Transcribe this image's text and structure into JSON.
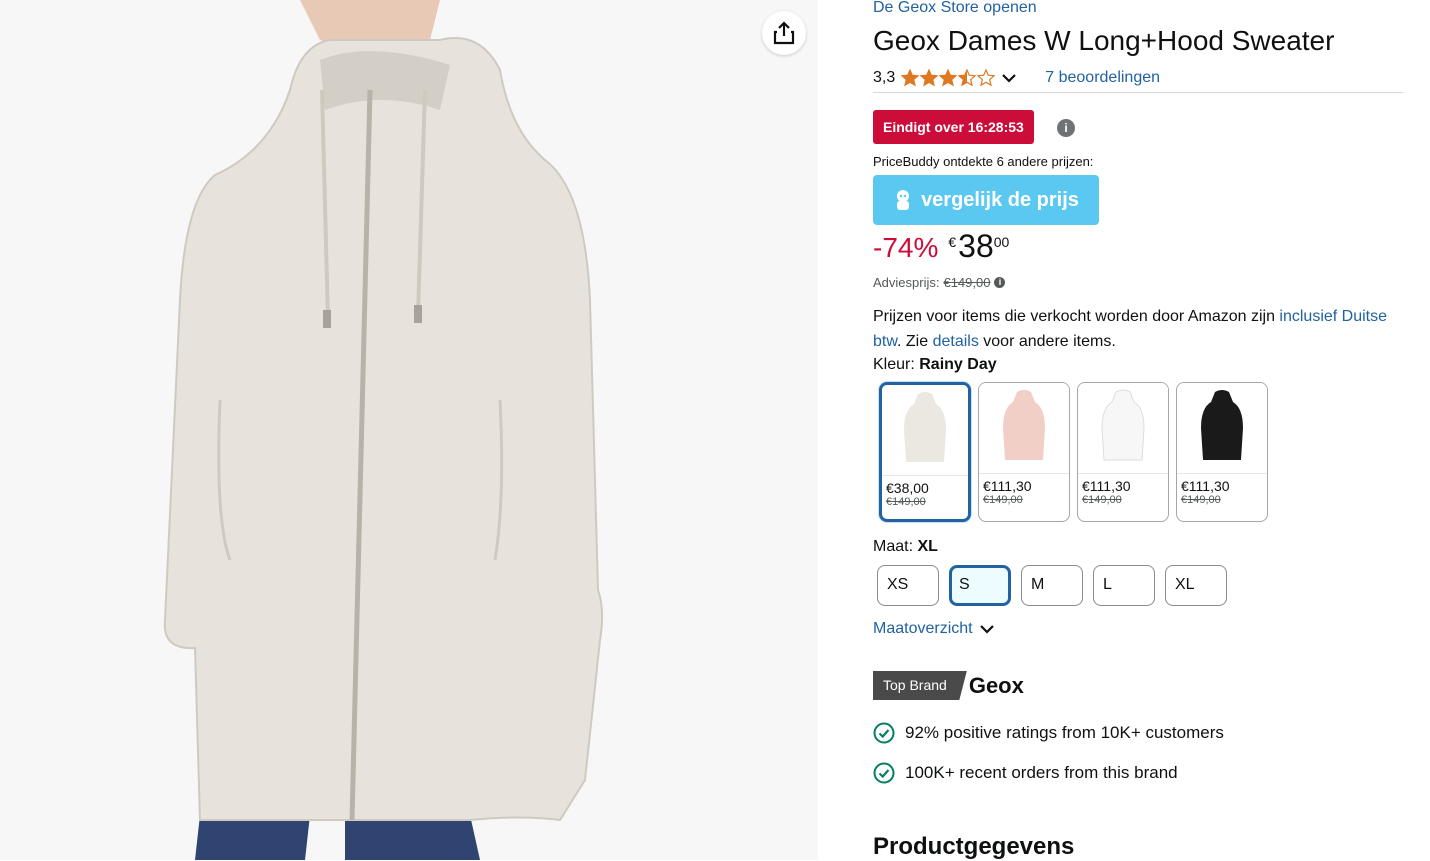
{
  "store": {
    "link": "De Geox Store openen"
  },
  "product": {
    "title": "Geox Dames W Long+Hood Sweater"
  },
  "rating": {
    "value": "3,3",
    "reviews": "7 beoordelingen",
    "stars": 3.5
  },
  "deal": {
    "badge": "Eindigt over 16:28:53",
    "info": "i"
  },
  "pricebuddy": {
    "text": "PriceBuddy ontdekte 6 andere prijzen:",
    "button": "vergelijk de prijs"
  },
  "price": {
    "discount": "-74%",
    "currency": "€",
    "whole": "38",
    "fraction": "00",
    "list_label": "Adviesprijs:",
    "list_value": "€149,00"
  },
  "vat": {
    "text1": "Prijzen voor items die verkocht worden door Amazon zijn ",
    "link1": "inclusief Duitse btw",
    "text2": ". Zie ",
    "link2": "details",
    "text3": " voor andere items."
  },
  "color": {
    "label": "Kleur: ",
    "selected": "Rainy Day",
    "options": [
      {
        "price": "€38,00",
        "old": "€149,00",
        "color": "#ebe8e1"
      },
      {
        "price": "€111,30",
        "old": "€149,00",
        "color": "#f1cfc6"
      },
      {
        "price": "€111,30",
        "old": "€149,00",
        "color": "#f7f7f7"
      },
      {
        "price": "€111,30",
        "old": "€149,00",
        "color": "#1a1a1a"
      }
    ]
  },
  "size": {
    "label": "Maat: ",
    "selected": "XL",
    "options": [
      "XS",
      "S",
      "M",
      "L",
      "XL"
    ],
    "guide": "Maatoverzicht"
  },
  "brand": {
    "badge": "Top Brand",
    "name": "Geox"
  },
  "features": [
    "92% positive ratings from 10K+ customers",
    "100K+ recent orders from this brand"
  ],
  "section": {
    "heading": "Productgegevens"
  },
  "colors": {
    "link": "#2162a1",
    "deal": "#cc0c39",
    "pricebuddy": "#5bc8f1",
    "star": "#de7921",
    "check": "#067d62"
  }
}
